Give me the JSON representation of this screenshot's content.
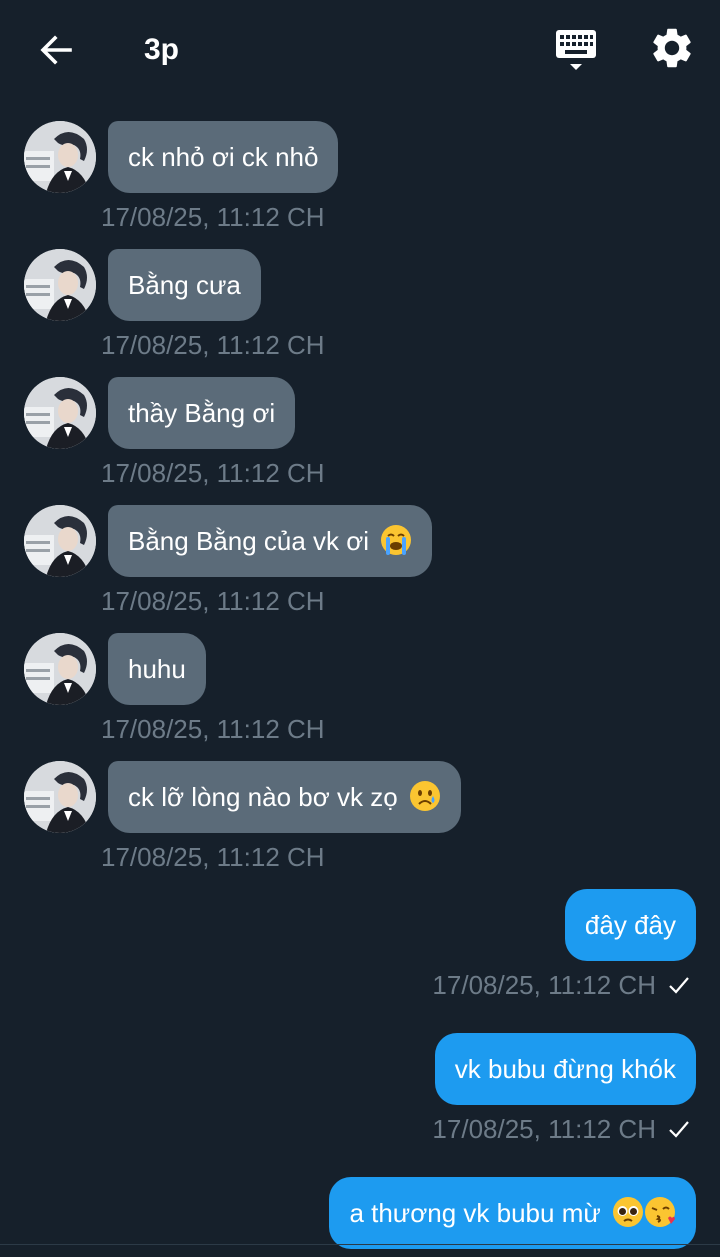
{
  "header": {
    "title": "3p",
    "back_icon": "arrow-left-icon",
    "keyboard_icon": "keyboard-icon",
    "settings_icon": "gear-icon"
  },
  "colors": {
    "background": "#16202b",
    "incoming_bubble": "#5b6b79",
    "outgoing_bubble": "#1d9bf0",
    "timestamp": "#6d7b88"
  },
  "incoming": [
    {
      "text": "ck nhỏ ơi ck nhỏ",
      "time": "17/08/25, 11:12 CH"
    },
    {
      "text": "Bằng cưa",
      "time": "17/08/25, 11:12 CH"
    },
    {
      "text": "thầy Bằng ơi",
      "time": "17/08/25, 11:12 CH"
    },
    {
      "text": "Bằng Bằng của vk ơi",
      "emoji": "loudly-crying-face",
      "time": "17/08/25, 11:12 CH"
    },
    {
      "text": "huhu",
      "time": "17/08/25, 11:12 CH"
    },
    {
      "text": "ck lỡ lòng nào bơ vk zọ",
      "emoji": "crying-face",
      "time": "17/08/25, 11:12 CH"
    }
  ],
  "outgoing": [
    {
      "text": "đây đây",
      "time": "17/08/25, 11:12 CH",
      "status": "sent-check-icon"
    },
    {
      "text": "vk bubu đừng khók",
      "time": "17/08/25, 11:12 CH",
      "status": "sent-check-icon"
    },
    {
      "text": "a thương vk bubu mừ",
      "emoji": "pleading-face, kissing-heart-face"
    }
  ]
}
